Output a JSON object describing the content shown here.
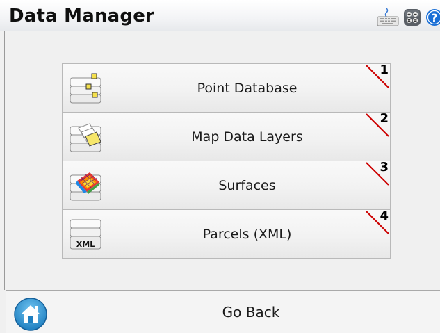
{
  "header": {
    "title": "Data Manager",
    "icons": [
      "keyboard-icon",
      "calculator-icon",
      "help-icon"
    ]
  },
  "menu": {
    "items": [
      {
        "label": "Point Database",
        "shortcut": "1",
        "icon": "point-database-icon"
      },
      {
        "label": "Map Data Layers",
        "shortcut": "2",
        "icon": "map-layers-icon"
      },
      {
        "label": "Surfaces",
        "shortcut": "3",
        "icon": "surfaces-icon"
      },
      {
        "label": "Parcels (XML)",
        "shortcut": "4",
        "icon": "parcels-xml-icon",
        "icon_text": "XML"
      }
    ]
  },
  "footer": {
    "label": "Go Back",
    "icon": "home-icon"
  },
  "colors": {
    "shortcut_marker": "#cc0000",
    "help_blue": "#1a6fd6",
    "home_blue": "#1f7fc0"
  }
}
